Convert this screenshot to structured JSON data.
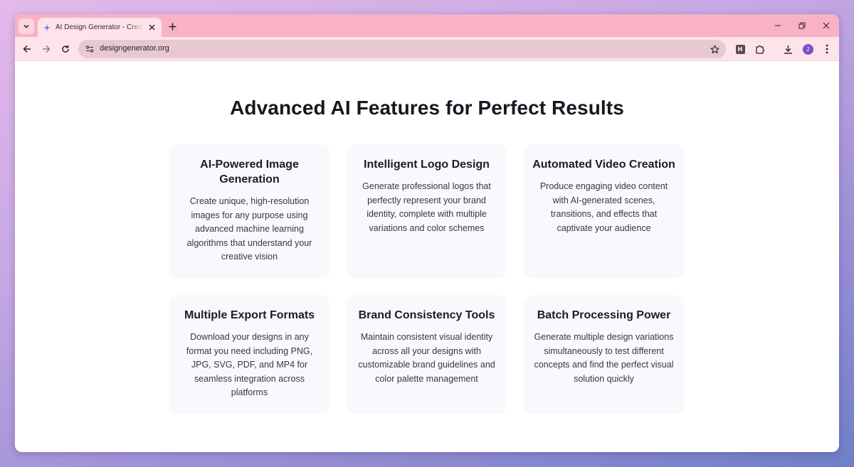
{
  "browser": {
    "tab": {
      "title": "AI Design Generator - Create Stunning Designs"
    },
    "address_bar": {
      "url": "designgenerator.org"
    },
    "extension_label": "H",
    "profile_initial": "J"
  },
  "page": {
    "heading": "Advanced AI Features for Perfect Results",
    "features": [
      {
        "title": "AI-Powered Image Generation",
        "description": "Create unique, high-resolution images for any purpose using advanced machine learning algorithms that understand your creative vision"
      },
      {
        "title": "Intelligent Logo Design",
        "description": "Generate professional logos that perfectly represent your brand identity, complete with multiple variations and color schemes"
      },
      {
        "title": "Automated Video Creation",
        "description": "Produce engaging video content with AI-generated scenes, transitions, and effects that captivate your audience"
      },
      {
        "title": "Multiple Export Formats",
        "description": "Download your designs in any format you need including PNG, JPG, SVG, PDF, and MP4 for seamless integration across platforms"
      },
      {
        "title": "Brand Consistency Tools",
        "description": "Maintain consistent visual identity across all your designs with customizable brand guidelines and color palette management"
      },
      {
        "title": "Batch Processing Power",
        "description": "Generate multiple design variations simultaneously to test different concepts and find the perfect visual solution quickly"
      }
    ]
  },
  "colors": {
    "titlebar": "#f8b2c4",
    "toolbar": "#fde4ea",
    "card_background": "#f8f9fc",
    "avatar": "#7f4fc9"
  }
}
